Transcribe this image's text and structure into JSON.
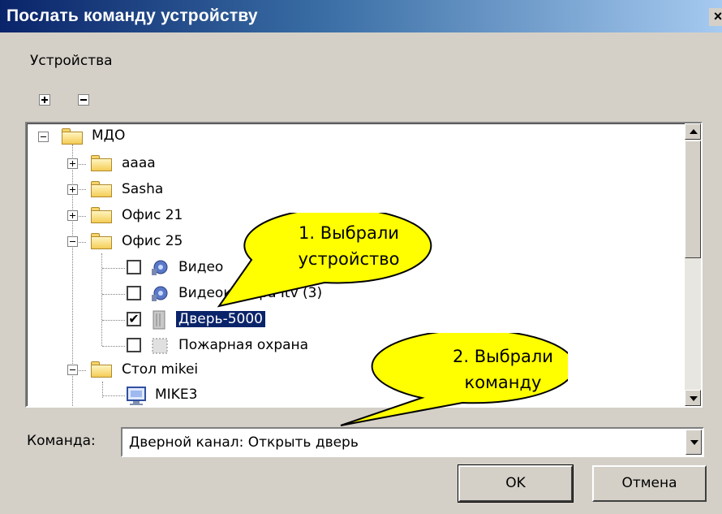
{
  "window": {
    "title": "Послать команду устройству",
    "close_glyph": "×"
  },
  "devices_label": "Устройства",
  "toolbar": {
    "expand_all_icon": "plus-box-icon",
    "collapse_all_icon": "minus-box-icon"
  },
  "tree": {
    "root": "МДО",
    "nodes": {
      "aaaa": "aaaa",
      "sasha": "Sasha",
      "office21": "Офис 21",
      "office25": "Офис 25",
      "video1": "Видео",
      "video2": "Видеокамера Itv (3)",
      "door": "Дверь-5000",
      "fire": "Пожарная охрана",
      "table": "Стол mikei",
      "mike3": "MIKE3"
    },
    "checked": {
      "video1": false,
      "video2": false,
      "door": true,
      "fire": false
    },
    "checkmark": "✔"
  },
  "callouts": {
    "first": [
      "1. Выбрали",
      "устройство"
    ],
    "second": [
      "2. Выбрали",
      "команду"
    ],
    "fill_color": "#ffff00"
  },
  "command": {
    "label": "Команда:",
    "value": "Дверной канал: Открыть дверь"
  },
  "buttons": {
    "ok": "OK",
    "cancel": "Отмена"
  }
}
